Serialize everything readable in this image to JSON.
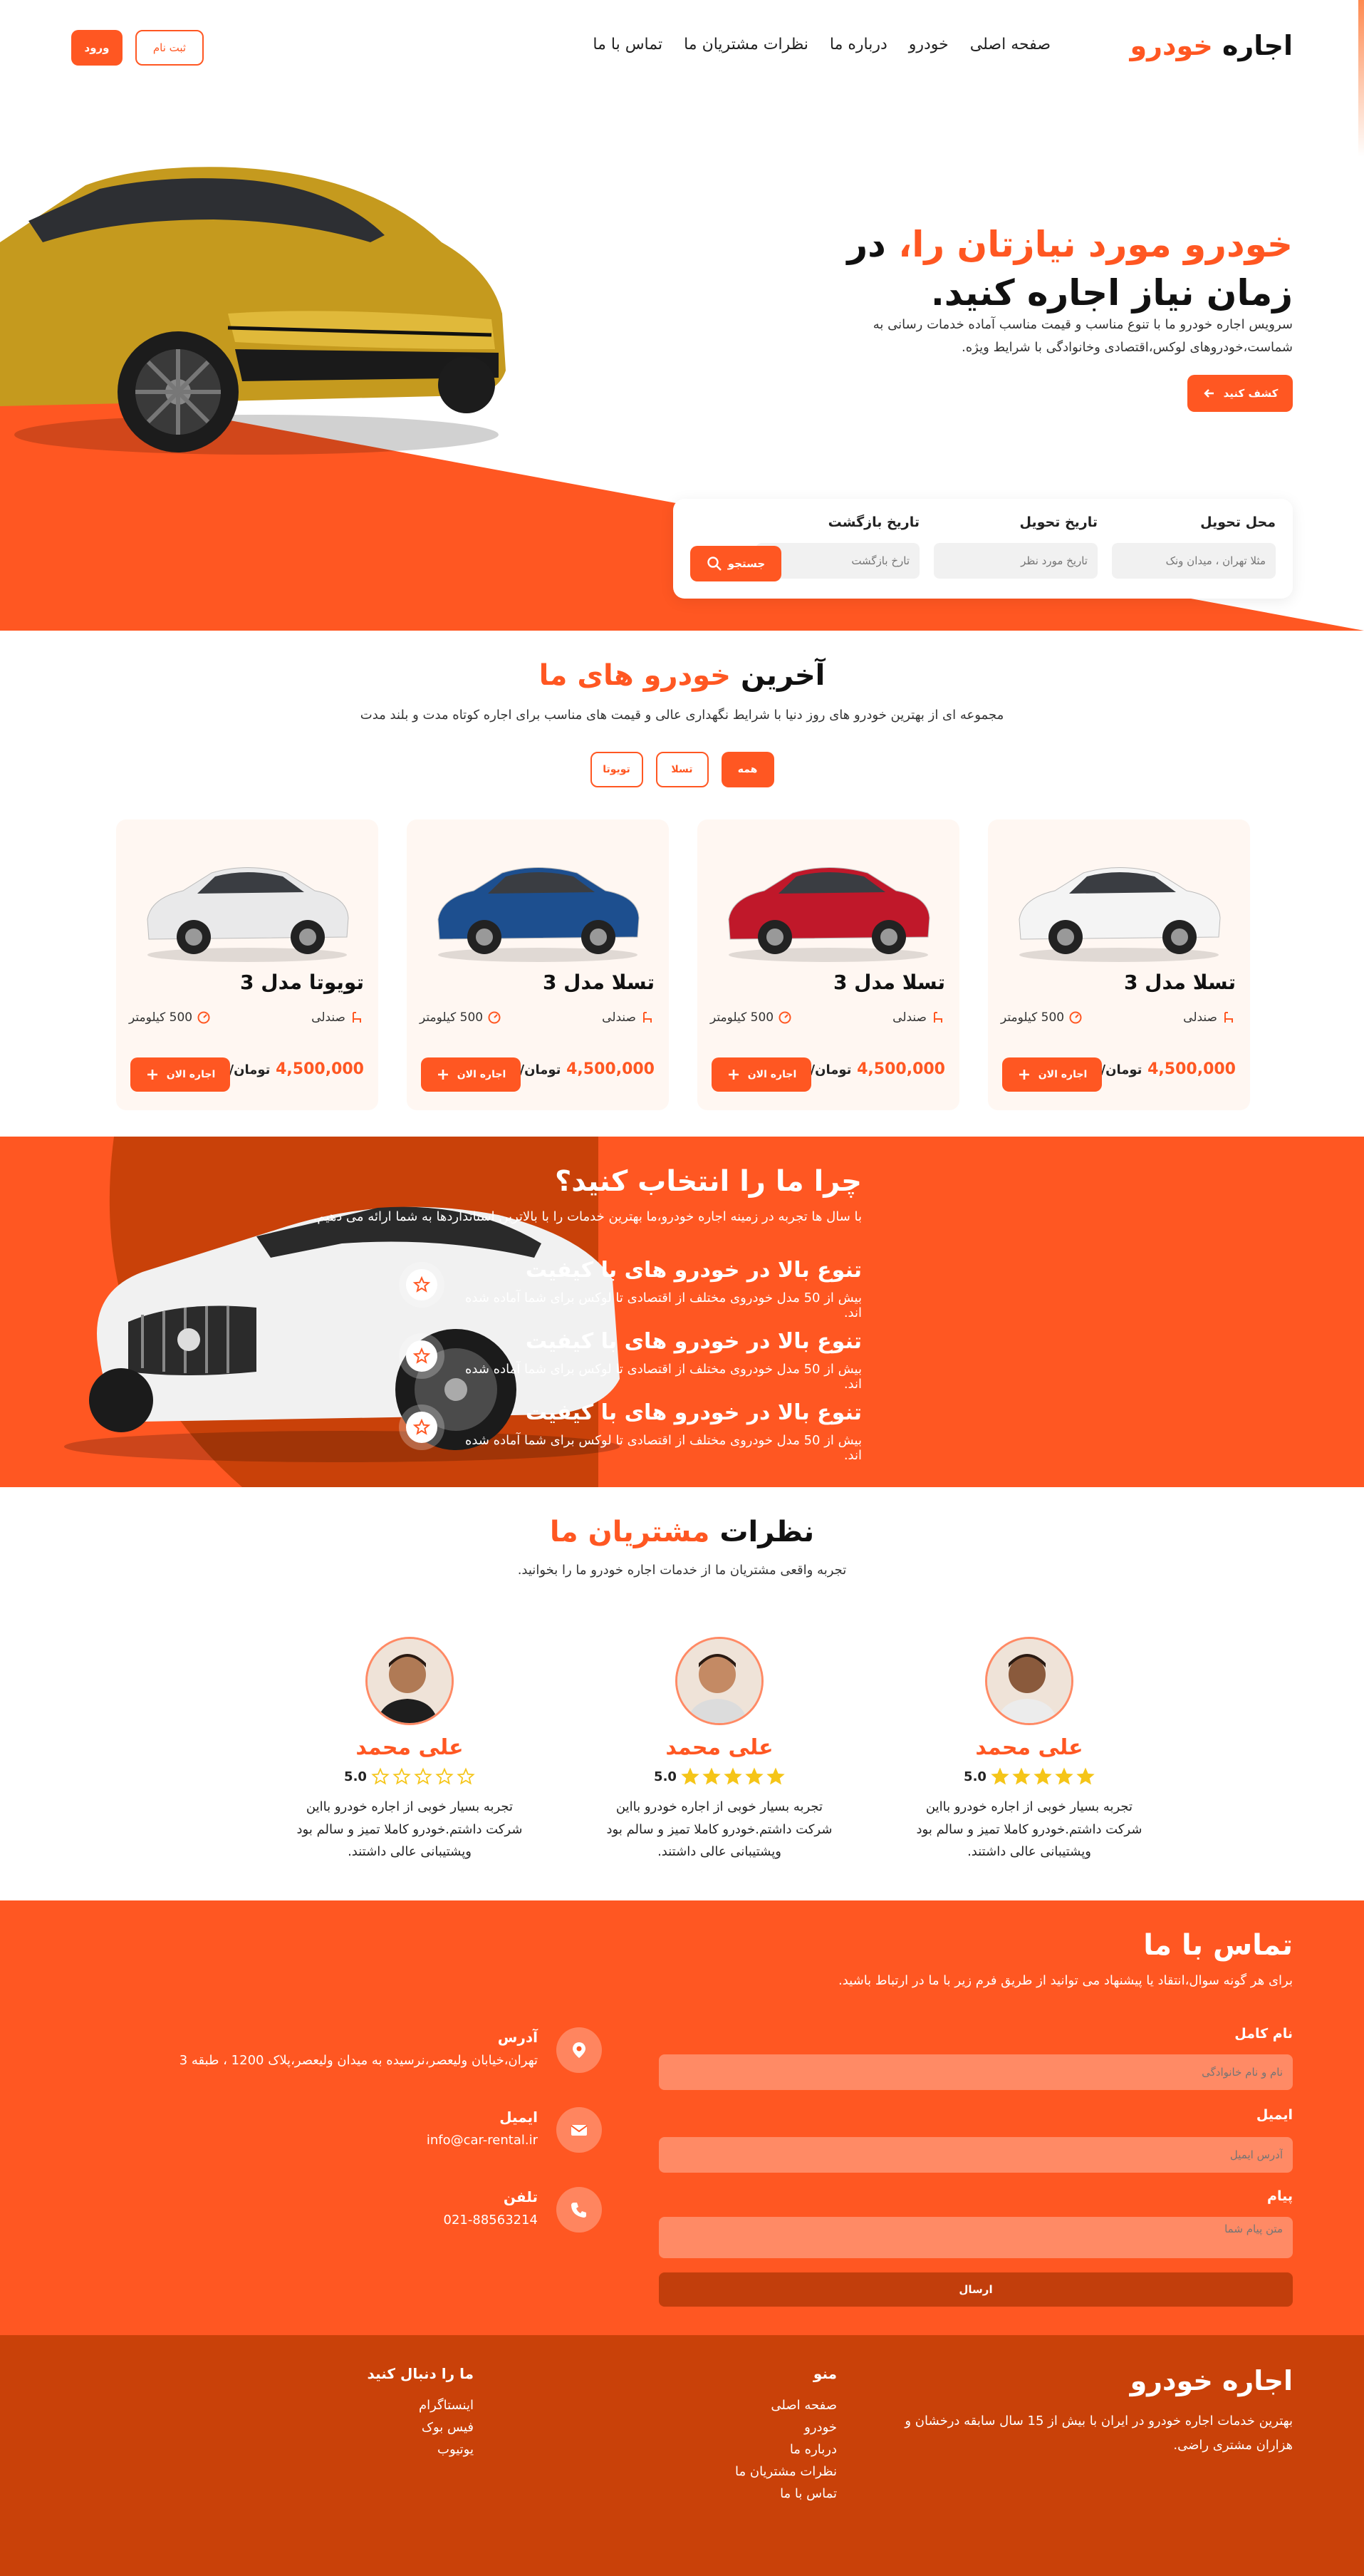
{
  "header": {
    "logo_part1": "اجاره",
    "logo_part2": "خودرو",
    "nav": [
      "صفحه اصلی",
      "خودرو",
      "درباره ما",
      "نظرات مشتریان ما",
      "تماس با ما"
    ],
    "login_label": "ورود",
    "signup_label": "ثبت نام"
  },
  "hero": {
    "title_highlight": "خودرو مورد نیازتان را،",
    "title_rest": " در زمان نیاز اجاره کنید.",
    "description": "سرویس اجاره خودرو ما با تنوع مناسب و قیمت مناسب آماده خدمات رسانی به شماست،خودروهای لوکس،اقتصادی وخانوادگی با شرایط ویژه.",
    "explore_label": "کشف کنید"
  },
  "search": {
    "pickup_label": "محل تحویل",
    "pickup_placeholder": "مثلا تهران ، میدان ونک",
    "delivery_label": "تاریخ تحویل",
    "delivery_placeholder": "تاریخ مورد نظر",
    "return_label": "تاریخ بازگشت",
    "return_placeholder": "تارخ بازگشت",
    "search_label": "جستجو"
  },
  "cars": {
    "title_part1": "آخرین",
    "title_part2": " خودرو های ما",
    "subtitle": "مجموعه ای از بهترین خودرو های روز دنیا با شرایط نگهداری عالی و قیمت های مناسب برای اجاره کوتاه مدت و بلند مدت",
    "filters": [
      "همه",
      "تسلا",
      "تویوتا"
    ],
    "items": [
      {
        "name": "تسلا مدل 3",
        "seat": "صندلی",
        "km": "500 کیلومتر",
        "price": "4,500,000",
        "unit": "تومان/روز",
        "rent": "اجاره الان",
        "color": "#f4f4f4"
      },
      {
        "name": "تسلا مدل 3",
        "seat": "صندلی",
        "km": "500 کیلومتر",
        "price": "4,500,000",
        "unit": "تومان/روز",
        "rent": "اجاره الان",
        "color": "#c0182a"
      },
      {
        "name": "تسلا مدل 3",
        "seat": "صندلی",
        "km": "500 کیلومتر",
        "price": "4,500,000",
        "unit": "تومان/روز",
        "rent": "اجاره الان",
        "color": "#1d4f8f"
      },
      {
        "name": "تویوتا مدل 3",
        "seat": "صندلی",
        "km": "500 کیلومتر",
        "price": "4,500,000",
        "unit": "تومان/روز",
        "rent": "اجاره الان",
        "color": "#e9e9ea"
      }
    ]
  },
  "why": {
    "title": "چرا ما را انتخاب کنید؟",
    "subtitle": "با سال ها تجربه در زمینه اجاره خودرو،ما بهترین خدمات را با بالاترین استانداردها به شما ارائه می دهیم.",
    "features": [
      {
        "title": "تنوع بالا در خودرو های با کیفیت",
        "desc": "بیش از 50 مدل خودروی مختلف از اقتصادی تا لوکس برای شما آماده شده اند."
      },
      {
        "title": "تنوع بالا در خودرو های با کیفیت",
        "desc": "بیش از 50 مدل خودروی مختلف از اقتصادی تا لوکس برای شما آماده شده اند."
      },
      {
        "title": "تنوع بالا در خودرو های با کیفیت",
        "desc": "بیش از 50 مدل خودروی مختلف از اقتصادی تا لوکس برای شما آماده شده اند."
      }
    ]
  },
  "testimonials": {
    "title_part1": "نظرات",
    "title_part2": " مشتریان ما",
    "subtitle": "تجربه واقعی مشتریان ما از خدمات اجاره خودرو ما را بخوانید.",
    "items": [
      {
        "name": "علی محمد",
        "score": "5.0",
        "stars_filled": 5,
        "text": "تجربه بسیار خوبی از اجاره خودرو بااین شرکت داشتم.خودرو کاملا تمیز و سالم بود وپشتیبانی عالی داشتند."
      },
      {
        "name": "علی محمد",
        "score": "5.0",
        "stars_filled": 5,
        "text": "تجربه بسیار خوبی از اجاره خودرو بااین شرکت داشتم.خودرو کاملا تمیز و سالم بود وپشتیبانی عالی داشتند."
      },
      {
        "name": "علی محمد",
        "score": "5.0",
        "stars_filled": 0,
        "text": "تجربه بسیار خوبی از اجاره خودرو بااین شرکت داشتم.خودرو کاملا تمیز و سالم بود وپشتیبانی عالی داشتند."
      }
    ]
  },
  "contact": {
    "title": "تماس با ما",
    "subtitle": "برای هر گونه سوال،انتقاد یا پیشنهاد می توانید از طریق فرم زیر با ما در ارتباط باشید.",
    "name_label": "نام کامل",
    "name_placeholder": "نام و نام خانوادگی",
    "email_label": "ایمیل",
    "email_placeholder": "آدرس ایمیل",
    "message_label": "پیام",
    "message_placeholder": "متن پیام شما",
    "send_label": "ارسال",
    "address_title": "آدرس",
    "address_value": "تهران،خیابان ولیعصر،نرسیده به میدان ولیعصر،پلاک 1200 ، طبقه 3",
    "email_title": "ایمیل",
    "email_value": "info@car-rental.ir",
    "phone_title": "تلفن",
    "phone_value": "021-88563214"
  },
  "footer": {
    "brand": "اجاره خودرو",
    "description": "بهترین خدمات اجاره خودرو در ایران با بیش از 15 سال سابقه درخشان و هزاران مشتری راضی.",
    "menu_title": "منو",
    "menu": [
      "صفحه اصلی",
      "خودرو",
      "درباره ما",
      "نظرات مشتریان ما",
      "تماس با ما"
    ],
    "social_title": "ما را دنبال کنید",
    "social": [
      "اینستاگرام",
      "فیس بوک",
      "یوتیوب"
    ]
  },
  "colors": {
    "accent": "#ff5722",
    "dark_accent": "#c94109",
    "button_dark": "#c23e0c"
  }
}
